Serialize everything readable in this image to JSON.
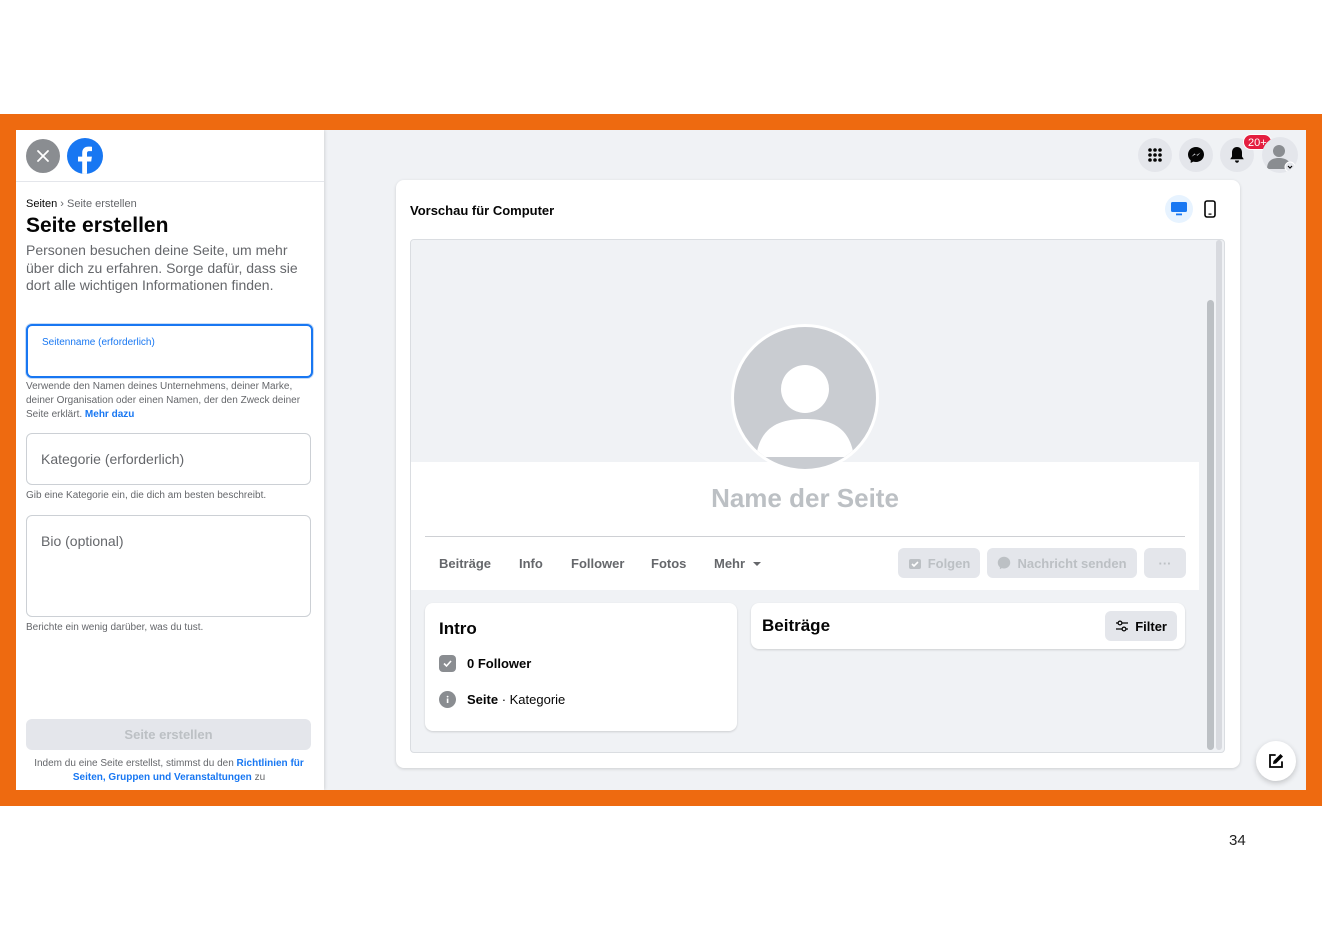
{
  "colors": {
    "frame": "#ee6a10",
    "accent": "#1877f2",
    "badge": "#e41e3f"
  },
  "left_panel": {
    "breadcrumb_root": "Seiten",
    "breadcrumb_sep": "›",
    "breadcrumb_current": "Seite erstellen",
    "title": "Seite erstellen",
    "intro": "Personen besuchen deine Seite, um mehr über dich zu erfahren. Sorge dafür, dass sie dort alle wichtigen Informationen finden.",
    "name_field_label": "Seitenname (erforderlich)",
    "name_helper": "Verwende den Namen deines Unternehmens, deiner Marke, deiner Organisation oder einen Namen, der den Zweck deiner Seite erklärt.",
    "name_helper_link": "Mehr dazu",
    "category_field_label": "Kategorie (erforderlich)",
    "category_helper": "Gib eine Kategorie ein, die dich am besten beschreibt.",
    "bio_field_label": "Bio (optional)",
    "bio_helper": "Berichte ein wenig darüber, was du tust.",
    "create_button": "Seite erstellen",
    "terms_prefix": "Indem du eine Seite erstellst, stimmst du den",
    "terms_link": "Richtlinien für Seiten, Gruppen und Veranstaltungen",
    "terms_suffix": "zu"
  },
  "header": {
    "icons": [
      "menu-grid-icon",
      "messenger-icon",
      "bell-icon"
    ],
    "notification_badge": "20+"
  },
  "preview": {
    "title": "Vorschau für Computer",
    "page_name": "Name der Seite",
    "tabs": [
      "Beiträge",
      "Info",
      "Follower",
      "Fotos",
      "Mehr"
    ],
    "follow_button": "Folgen",
    "message_button": "Nachricht senden",
    "more_button": "···",
    "intro_card": {
      "title": "Intro",
      "followers": "0 Follower",
      "type_bold": "Seite",
      "type_sep": " · ",
      "type_rest": "Kategorie"
    },
    "posts_card": {
      "title": "Beiträge",
      "filter_button": "Filter"
    }
  },
  "slide": {
    "page_number": "34"
  }
}
